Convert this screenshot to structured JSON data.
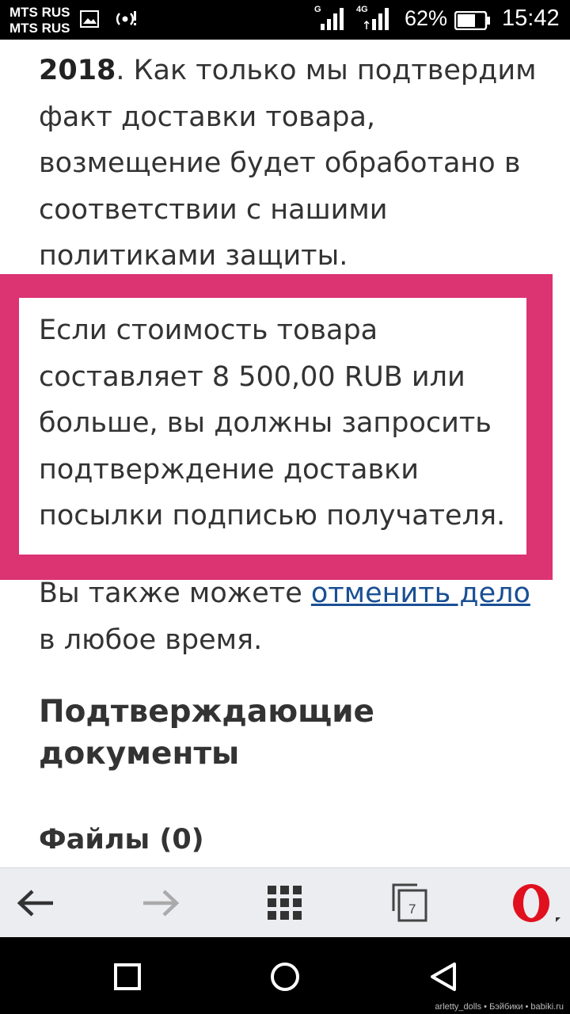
{
  "status_bar": {
    "carrier_1": "MTS RUS",
    "carrier_2": "MTS RUS",
    "sim1_tag": "G",
    "sim2_tag": "4G",
    "battery_percent": "62%",
    "time": "15:42"
  },
  "content": {
    "para1_bold": "2018",
    "para1_rest": ". Как только мы подтвердим факт доставки товара, возмещение будет обработано в соответствии с нашими политиками защиты.",
    "alert_text": "Если стоимость товара составляет 8 500,00 RUB или больше, вы должны запросить подтверждение доставки посылки подписью получателя.",
    "para3_before": "Вы также можете ",
    "para3_link": "отменить дело",
    "para3_after": " в любое время.",
    "heading": "Подтверждающие документы",
    "files_label": "Файлы (0)"
  },
  "browser_toolbar": {
    "back_icon": "arrow-left-icon",
    "forward_icon": "arrow-right-icon",
    "speed_dial_icon": "grid-icon",
    "tabs_icon": "tabs-icon",
    "tab_count": "7",
    "menu_icon": "opera-logo-icon"
  },
  "nav_bar": {
    "recent_icon": "square-icon",
    "home_icon": "circle-icon",
    "back_icon": "triangle-back-icon"
  },
  "watermark": "arletty_dolls • Бэйбики • babiki.ru",
  "colors": {
    "alert_frame": "#dc3373",
    "link": "#1a4f94",
    "opera_red": "#e0101e",
    "toolbar_bg": "#ecedf1"
  }
}
